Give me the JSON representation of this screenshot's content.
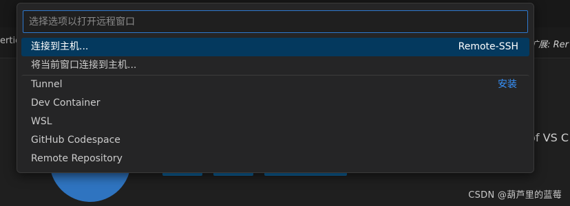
{
  "background": {
    "left_fragment": "ertie",
    "right_fragment": "扩展: Rer",
    "mid_fragment": "of VS C"
  },
  "quick_pick": {
    "placeholder": "选择选项以打开远程窗口",
    "input_value": "",
    "items": [
      {
        "label": "连接到主机...",
        "detail": "Remote-SSH",
        "selected": true
      },
      {
        "label": "将当前窗口连接到主机...",
        "detail": ""
      },
      {
        "label": "Tunnel",
        "action": "安装"
      },
      {
        "label": "Dev Container"
      },
      {
        "label": "WSL"
      },
      {
        "label": "GitHub Codespace"
      },
      {
        "label": "Remote Repository"
      }
    ]
  },
  "watermark": "CSDN @葫芦里的蓝莓",
  "colors": {
    "selection": "#04395e",
    "focus_border": "#2e7ad1",
    "action_link": "#3794ff",
    "panel": "#252526"
  }
}
